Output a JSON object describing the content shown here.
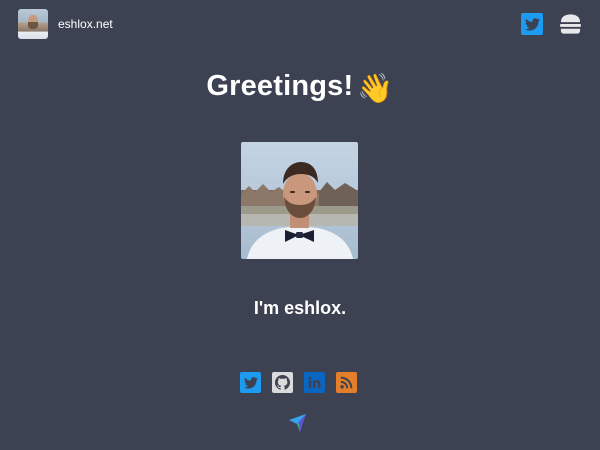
{
  "header": {
    "site_name": "eshlox.net",
    "avatar_icon": "avatar-photo",
    "twitter_icon": "twitter-icon",
    "menu_icon": "hamburger-menu-icon"
  },
  "main": {
    "greeting": "Greetings!",
    "greeting_emoji": "👋",
    "tagline": "I'm eshlox."
  },
  "social": [
    {
      "name": "twitter",
      "icon": "twitter-icon",
      "color": "#1d9bf0"
    },
    {
      "name": "github",
      "icon": "github-icon",
      "color": "#d9dadc"
    },
    {
      "name": "linkedin",
      "icon": "linkedin-icon",
      "color": "#0a66c2"
    },
    {
      "name": "rss",
      "icon": "rss-icon",
      "color": "#e37f2a"
    }
  ],
  "colors": {
    "background": "#3c4252",
    "text": "#ffffff",
    "twitter_blue": "#1d9bf0"
  },
  "footer": {
    "logo_icon": "paper-plane-logo-icon"
  }
}
